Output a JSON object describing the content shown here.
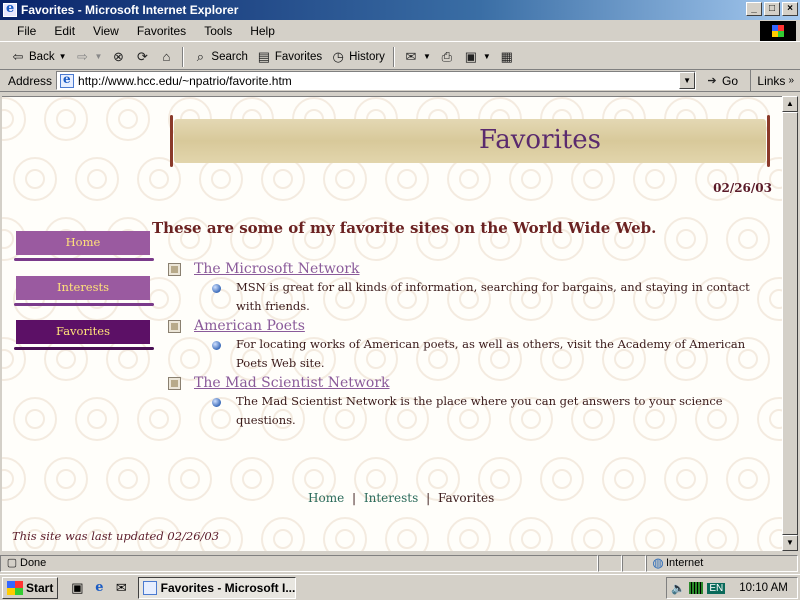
{
  "window": {
    "title": "Favorites - Microsoft Internet Explorer",
    "buttons": [
      "_",
      "□",
      "×"
    ]
  },
  "menu": [
    "File",
    "Edit",
    "View",
    "Favorites",
    "Tools",
    "Help"
  ],
  "toolbar": {
    "back": "Back",
    "search": "Search",
    "favorites": "Favorites",
    "history": "History"
  },
  "address": {
    "label": "Address",
    "url": "http://www.hcc.edu/~npatrio/favorite.htm",
    "go": "Go",
    "links": "Links"
  },
  "page": {
    "title": "Favorites",
    "date": "02/26/03",
    "nav": [
      {
        "label": "Home",
        "active": false
      },
      {
        "label": "Interests",
        "active": false
      },
      {
        "label": "Favorites",
        "active": true
      }
    ],
    "intro": "These are some of my favorite sites on the World Wide Web.",
    "sites": [
      {
        "name": "The Microsoft Network",
        "description": "MSN is great for all kinds of information, searching for bargains, and staying in contact with friends."
      },
      {
        "name": "American Poets",
        "description": "For locating works of American poets, as well as others, visit the Academy of American Poets Web site."
      },
      {
        "name": "The Mad Scientist Network",
        "description": "The Mad Scientist Network is the place where you can get answers to your science questions."
      }
    ],
    "footer_nav": [
      "Home",
      "Interests",
      "Favorites"
    ],
    "footer_sep": "|",
    "updated": "This site was last updated 02/26/03"
  },
  "status": {
    "text": "Done",
    "zone": "Internet"
  },
  "taskbar": {
    "start": "Start",
    "task": "Favorites - Microsoft I...",
    "lang": "EN",
    "time": "10:10 AM"
  }
}
